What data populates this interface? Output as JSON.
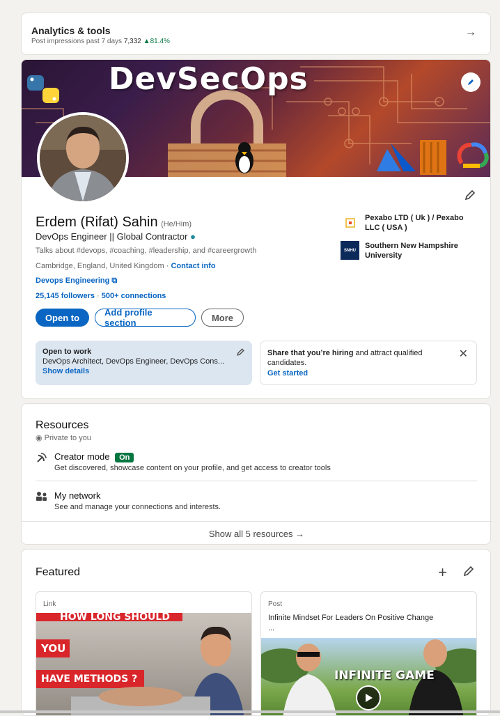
{
  "analytics": {
    "title": "Analytics & tools",
    "impressions_label": "Post impressions past 7 days",
    "impressions_value": "7,332",
    "change": "81.4%"
  },
  "profile": {
    "banner_title": "DevSecOps",
    "name": "Erdem (Rifat) Sahin",
    "pronouns": "(He/Him)",
    "headline": "DevOps Engineer || Global Contractor",
    "talks": "Talks about #devops, #coaching, #leadership, and #careergrowth",
    "location": "Cambridge, England, United Kingdom",
    "location_sep": " · ",
    "contact_info": "Contact info",
    "website": "Devops Engineering",
    "followers": "25,145 followers",
    "stats_sep": " · ",
    "connections": "500+ connections",
    "buttons": {
      "open_to": "Open to",
      "add_section": "Add profile section",
      "more": "More"
    },
    "companies": [
      {
        "name": "Pexabo LTD ( Uk ) / Pexabo LLC ( USA )"
      },
      {
        "name": "Southern New Hampshire University"
      }
    ],
    "snhu_logo_text": "SNHU",
    "open_to_work": {
      "title": "Open to work",
      "roles": "DevOps Architect, DevOps Engineer, DevOps Cons...",
      "link": "Show details"
    },
    "hiring": {
      "bold": "Share that you’re hiring",
      "rest": " and attract qualified candidates.",
      "link": "Get started"
    }
  },
  "resources": {
    "title": "Resources",
    "private": "Private to you",
    "items": [
      {
        "title": "Creator mode",
        "badge": "On",
        "desc": "Get discovered, showcase content on your profile, and get access to creator tools"
      },
      {
        "title": "My network",
        "desc": "See and manage your connections and interests."
      }
    ],
    "show_all": "Show all 5 resources →"
  },
  "featured": {
    "title": "Featured",
    "cards": [
      {
        "type": "Link",
        "thumb_lines": [
          "HOW LONG SHOULD",
          "YOU",
          "HAVE METHODS ?"
        ]
      },
      {
        "type": "Post",
        "title": "Infinite Mindset For Leaders On Positive Change",
        "ellipsis": "...",
        "thumb_text": "INFINITE GAME"
      }
    ]
  },
  "colors": {
    "accent": "#0a66c2",
    "positive": "#057642",
    "background": "#f3f2ef"
  }
}
